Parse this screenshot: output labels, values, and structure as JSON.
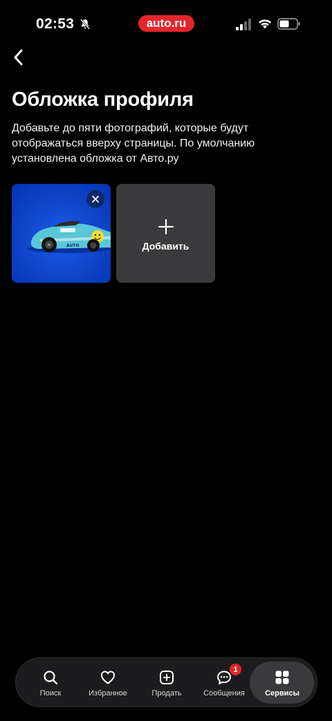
{
  "status_bar": {
    "time": "02:53",
    "brand": "auto.ru",
    "brand_color": "#e3262a"
  },
  "header": {
    "back_icon": "chevron-left-icon"
  },
  "page": {
    "title": "Обложка профиля",
    "description_lines": [
      "Добавьте до пяти фотографий, которые будут",
      "отображаться вверху страницы. По умолчанию",
      "установлена обложка от Авто.ру"
    ]
  },
  "covers": {
    "remove_icon": "close-icon",
    "add_label": "Добавить",
    "add_icon": "plus-icon"
  },
  "bottom_nav": {
    "items": [
      {
        "label": "Поиск",
        "icon": "search-icon"
      },
      {
        "label": "Избранное",
        "icon": "heart-icon"
      },
      {
        "label": "Продать",
        "icon": "plus-square-icon"
      },
      {
        "label": "Сообщения",
        "icon": "chat-icon",
        "badge": "1"
      },
      {
        "label": "Сервисы",
        "icon": "grid-icon",
        "active": true
      }
    ]
  }
}
